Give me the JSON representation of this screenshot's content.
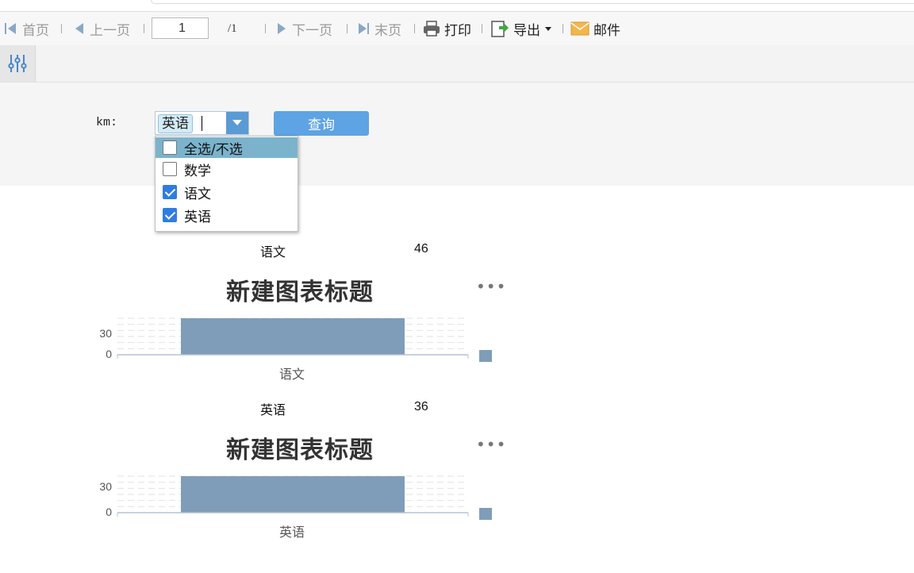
{
  "toolbar": {
    "first": "首页",
    "prev": "上一页",
    "page": "1",
    "total": "/1",
    "next": "下一页",
    "last": "末页",
    "print": "打印",
    "export": "导出",
    "mail": "邮件"
  },
  "params": {
    "label": "km:",
    "selected_tag": "英语",
    "query_label": "查询",
    "options": [
      {
        "label": "全选/不选",
        "checked": false,
        "highlighted": true
      },
      {
        "label": "数学",
        "checked": false,
        "highlighted": false
      },
      {
        "label": "语文",
        "checked": true,
        "highlighted": false
      },
      {
        "label": "英语",
        "checked": true,
        "highlighted": false
      }
    ]
  },
  "report": {
    "rows": [
      {
        "subject": "语文",
        "value": "46"
      },
      {
        "subject": "英语",
        "value": "36"
      }
    ]
  },
  "chart_data": [
    {
      "type": "bar",
      "title": "新建图表标题",
      "categories": [
        "语文"
      ],
      "values": [
        46
      ],
      "yticks": [
        "30",
        "0"
      ],
      "ylim": [
        0,
        46
      ],
      "color": "#7f9db8",
      "grid": true,
      "legend": "right"
    },
    {
      "type": "bar",
      "title": "新建图表标题",
      "categories": [
        "英语"
      ],
      "values": [
        36
      ],
      "yticks": [
        "30",
        "0"
      ],
      "ylim": [
        0,
        36
      ],
      "color": "#7f9db8",
      "grid": true,
      "legend": "right"
    }
  ]
}
